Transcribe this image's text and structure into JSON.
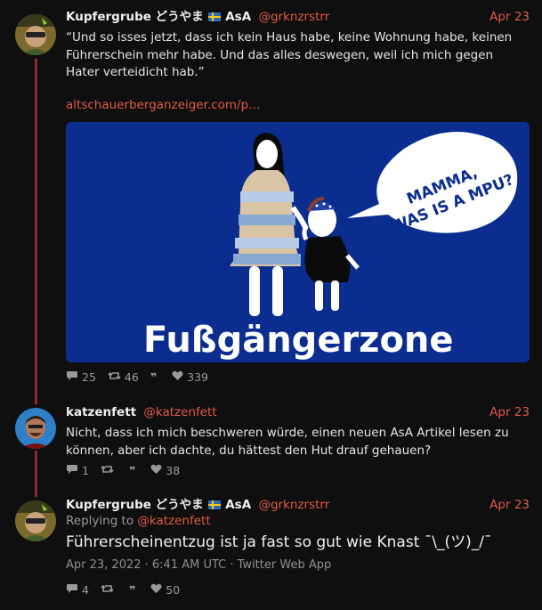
{
  "tweets": [
    {
      "name": "Kupfergrube どうやま",
      "name_suffix": "AsA",
      "handle": "@grknzrstrr",
      "date": "Apr 23",
      "text": "“Und so isses jetzt, dass ich kein Haus habe, keine Wohnung habe, keinen Führerschein mehr habe. Und das alles deswegen, weil ich mich gegen Hater verteidicht hab.”",
      "link": "altschauerberganzeiger.com/p…",
      "media": {
        "speech_bubble": [
          "MAMMA,",
          "WAS IS A MPU?"
        ],
        "caption": "Fußgängerzone"
      },
      "stats": {
        "replies": "25",
        "retweets": "46",
        "likes": "339"
      }
    },
    {
      "name": "katzenfett",
      "handle": "@katzenfett",
      "date": "Apr 23",
      "text": "Nicht, dass ich mich beschweren würde, einen neuen AsA Artikel lesen zu können, aber ich dachte, du hättest den Hut drauf gehauen?",
      "stats": {
        "replies": "1",
        "likes": "38"
      }
    },
    {
      "name": "Kupfergrube どうやま",
      "name_suffix": "AsA",
      "handle": "@grknzrstrr",
      "date": "Apr 23",
      "replying_label": "Replying to",
      "replying_handle": "@katzenfett",
      "text": "Führerscheinentzug ist ja fast so gut wie Knast ¯\\_(ツ)_/¯",
      "meta": "Apr 23, 2022 · 6:41 AM UTC · Twitter Web App",
      "stats": {
        "replies": "4",
        "likes": "50"
      }
    }
  ],
  "colors": {
    "accent": "#e05a4b",
    "background": "#0f0f0f",
    "thread_line": "#8a2b24",
    "media_bg": "#0a2d8f"
  },
  "icons": {
    "reply": "comment-icon",
    "retweet": "retweet-icon",
    "quote": "quote-icon",
    "like": "heart-icon",
    "flag": "swedish-flag-icon"
  }
}
